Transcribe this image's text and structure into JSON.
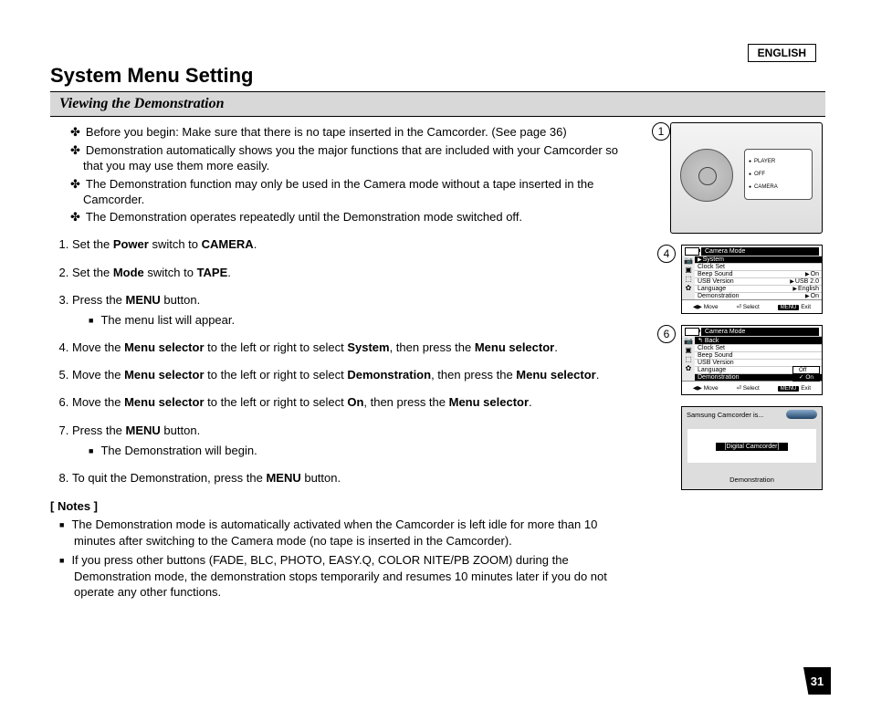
{
  "lang_label": "ENGLISH",
  "title": "System Menu Setting",
  "section": "Viewing the Demonstration",
  "intro": [
    "Before you begin: Make sure that there is no tape inserted in the Camcorder. (See page 36)",
    "Demonstration automatically shows you the major functions that are included with your Camcorder so that you may use them more easily.",
    "The Demonstration function may only be used in the Camera mode without a tape inserted in the Camcorder.",
    "The Demonstration operates repeatedly until the Demonstration mode switched off."
  ],
  "steps": {
    "s1_a": "Set the ",
    "s1_b": "Power",
    "s1_c": " switch to ",
    "s1_d": "CAMERA",
    "s1_e": ".",
    "s2_a": "Set the ",
    "s2_b": "Mode",
    "s2_c": " switch to ",
    "s2_d": "TAPE",
    "s2_e": ".",
    "s3_a": "Press the ",
    "s3_b": "MENU",
    "s3_c": " button.",
    "s3_sub": "The menu list will appear.",
    "s4_a": "Move the ",
    "s4_b": "Menu selector",
    "s4_c": " to the left or right to select ",
    "s4_d": "System",
    "s4_e": ", then press the ",
    "s4_f": "Menu selector",
    "s4_g": ".",
    "s5_a": "Move the ",
    "s5_b": "Menu selector",
    "s5_c": " to the left or right to select ",
    "s5_d": "Demonstration",
    "s5_e": ", then press the ",
    "s5_f": "Menu selector",
    "s5_g": ".",
    "s6_a": "Move the ",
    "s6_b": "Menu selector",
    "s6_c": " to the left or right to select ",
    "s6_d": "On",
    "s6_e": ", then press the ",
    "s6_f": "Menu selector",
    "s6_g": ".",
    "s7_a": "Press the ",
    "s7_b": "MENU",
    "s7_c": " button.",
    "s7_sub": "The Demonstration will begin.",
    "s8_a": "To quit the Demonstration, press the ",
    "s8_b": "MENU",
    "s8_c": " button."
  },
  "notes_head": "[ Notes ]",
  "notes": [
    "The Demonstration mode is automatically activated when the Camcorder is left idle for more than 10 minutes after switching to the Camera mode (no tape is inserted in the Camcorder).",
    "If you press other buttons (FADE, BLC, PHOTO, EASY.Q, COLOR NITE/PB ZOOM) during the Demonstration mode, the demonstration stops temporarily and resumes 10 minutes later if you do not operate any other functions."
  ],
  "fig_numbers": {
    "f1": "1",
    "f4": "4",
    "f6": "6"
  },
  "modes": {
    "player": "PLAYER",
    "off": "OFF",
    "camera": "CAMERA"
  },
  "osd": {
    "title": "Camera Mode",
    "system": "System",
    "back": "Back",
    "rows": {
      "clock": "Clock Set",
      "beep": "Beep Sound",
      "beep_v": "On",
      "usb": "USB Version",
      "usb_v": "USB 2.0",
      "lang": "Language",
      "lang_v": "English",
      "demo": "Demonstration",
      "demo_v": "On"
    },
    "options": {
      "off": "Off",
      "on": "On"
    },
    "foot": {
      "move": "Move",
      "select": "Select",
      "menu": "MENU",
      "exit": "Exit"
    }
  },
  "demo_screen": {
    "hdr": "Samsung Camcorder is...",
    "mid": "[Digital Camcorder]",
    "ftr": "Demonstration"
  },
  "page_number": "31"
}
